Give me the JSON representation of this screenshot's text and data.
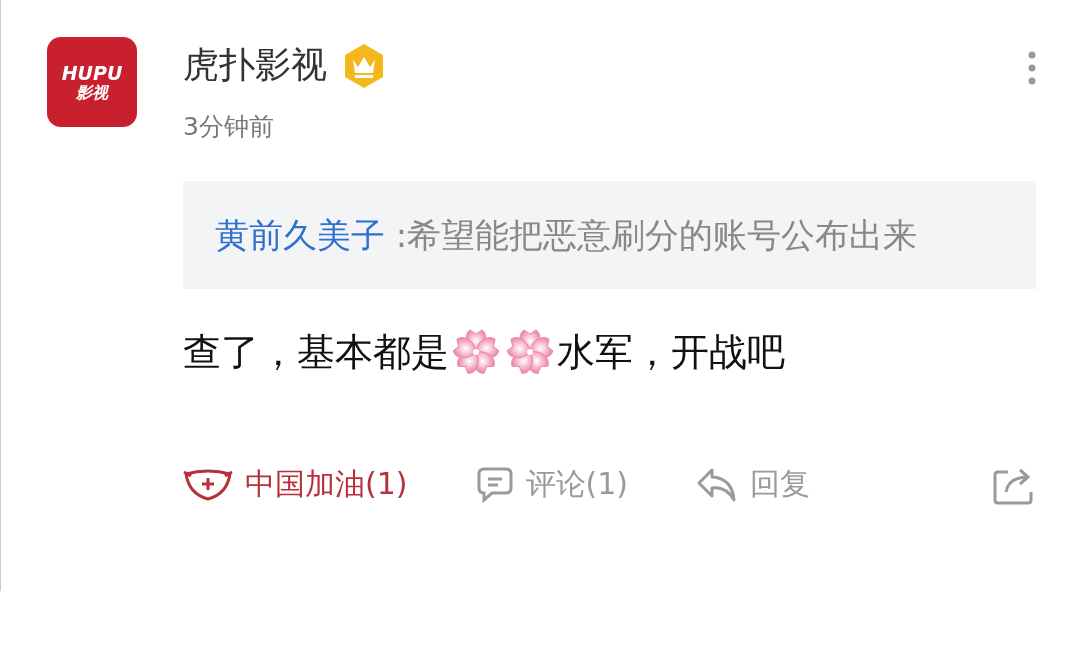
{
  "post": {
    "avatar": {
      "logo_line_1": "HUPU",
      "logo_line_2": "影视"
    },
    "author": "虎扑影视",
    "verified": true,
    "time": "3分钟前",
    "quote": {
      "author": "黄前久美子",
      "separator": ":",
      "text": "希望能把恶意刷分的账号公布出来"
    },
    "body": [
      {
        "kind": "text",
        "text": "查了，基本都是"
      },
      {
        "kind": "blossom"
      },
      {
        "kind": "blossom"
      },
      {
        "kind": "text",
        "text": "水军，开战吧"
      }
    ],
    "actions": [
      {
        "kind": "cheer",
        "label": "中国加油(1)",
        "active": true
      },
      {
        "kind": "comment",
        "label": "评论(1)",
        "active": false
      },
      {
        "kind": "reply",
        "label": "回复",
        "active": false
      },
      {
        "kind": "share"
      }
    ]
  }
}
